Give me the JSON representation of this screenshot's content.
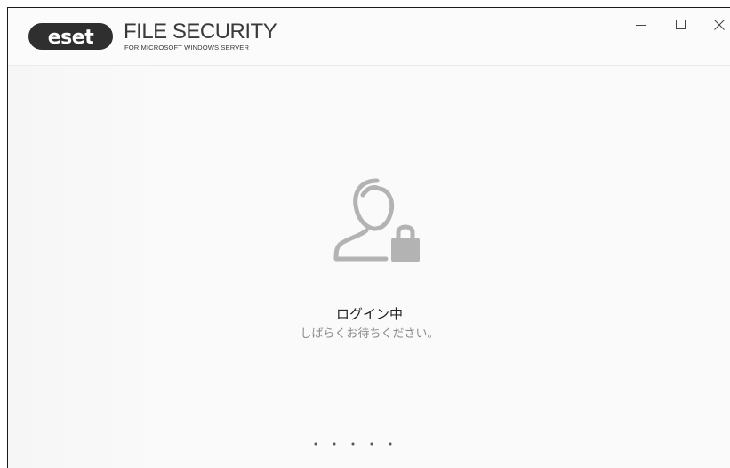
{
  "app": {
    "brand": "eset",
    "product_name": "FILE SECURITY",
    "product_subtitle": "FOR MICROSOFT WINDOWS SERVER"
  },
  "window_controls": {
    "minimize_icon": "minimize-icon",
    "maximize_icon": "maximize-icon",
    "close_icon": "close-icon"
  },
  "status": {
    "icon": "user-lock-icon",
    "title": "ログイン中",
    "message": "しばらくお待ちください。"
  },
  "progress": {
    "indicator": "loading-dots",
    "dot_count": 5
  },
  "colors": {
    "icon_gray": "#b3b3b3",
    "logo_dark": "#2f2f2f",
    "title_text": "#222222",
    "sub_text": "#8a8a8a"
  }
}
